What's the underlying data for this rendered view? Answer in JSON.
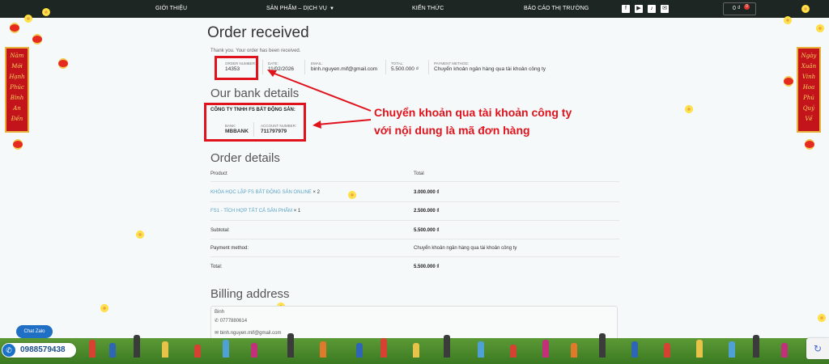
{
  "nav": {
    "items": [
      "GIỚI THIỆU",
      "SẢN PHẨM – DỊCH VỤ",
      "KIẾN THỨC",
      "BÁO CÁO THỊ TRƯỜNG"
    ],
    "social_icons": [
      "facebook-icon",
      "youtube-icon",
      "tiktok-icon",
      "email-icon"
    ],
    "cart_total": "0 ₫",
    "cart_count": "0"
  },
  "order": {
    "title": "Order received",
    "thanks": "Thank you. Your order has been received.",
    "overview": [
      {
        "label": "ORDER NUMBER:",
        "value": "14353"
      },
      {
        "label": "DATE:",
        "value": "11/02/2026"
      },
      {
        "label": "EMAIL:",
        "value": "binh.nguyen.mif@gmail.com"
      },
      {
        "label": "TOTAL:",
        "value": "5.500.000 ₫"
      },
      {
        "label": "PAYMENT METHOD:",
        "value": "Chuyển khoản ngân hàng qua tài khoản công ty"
      }
    ]
  },
  "bank": {
    "title": "Our bank details",
    "company": "CÔNG TY TNHH FS BẤT ĐỘNG SẢN:",
    "bank_label": "BANK:",
    "bank_value": "MBBANK",
    "account_label": "ACCOUNT NUMBER:",
    "account_value": "711797979"
  },
  "annotation": "Chuyển khoản qua tài khoản công ty với nội dung là mã đơn hàng",
  "details": {
    "title": "Order details",
    "col_product": "Product",
    "col_total": "Total",
    "rows": [
      {
        "name": "KHÓA HỌC LẬP FS BẤT ĐỘNG SẢN ONLINE",
        "qty": "× 2",
        "total": "3.000.000 ₫"
      },
      {
        "name": "FS1 - TÍCH HỢP TẤT CẢ SẢN PHẨM",
        "qty": "× 1",
        "total": "2.500.000 ₫"
      }
    ],
    "subtotal_label": "Subtotal:",
    "subtotal_value": "5.500.000 ₫",
    "payment_label": "Payment method:",
    "payment_value": "Chuyển khoản ngân hàng qua tài khoản công ty",
    "total_label": "Total:",
    "total_value": "5.500.000 ₫"
  },
  "billing": {
    "title": "Billing address",
    "name": "Binh",
    "phone": "0777880614",
    "email": "binh.nguyen.mif@gmail.com"
  },
  "decor": {
    "left_banner": [
      "Năm",
      "Mới",
      "Hạnh",
      "Phúc",
      "Bình",
      "An",
      "Đến"
    ],
    "right_banner": [
      "Ngày",
      "Xuân",
      "Vinh",
      "Hoa",
      "Phú",
      "Quý",
      "Về"
    ]
  },
  "widgets": {
    "chat_zalo": "Chat Zalo",
    "hotline": "0988579438"
  },
  "colors": {
    "nav_bg": "#1e2624",
    "highlight_red": "#e0131c",
    "link_blue": "#5ba3c6"
  }
}
